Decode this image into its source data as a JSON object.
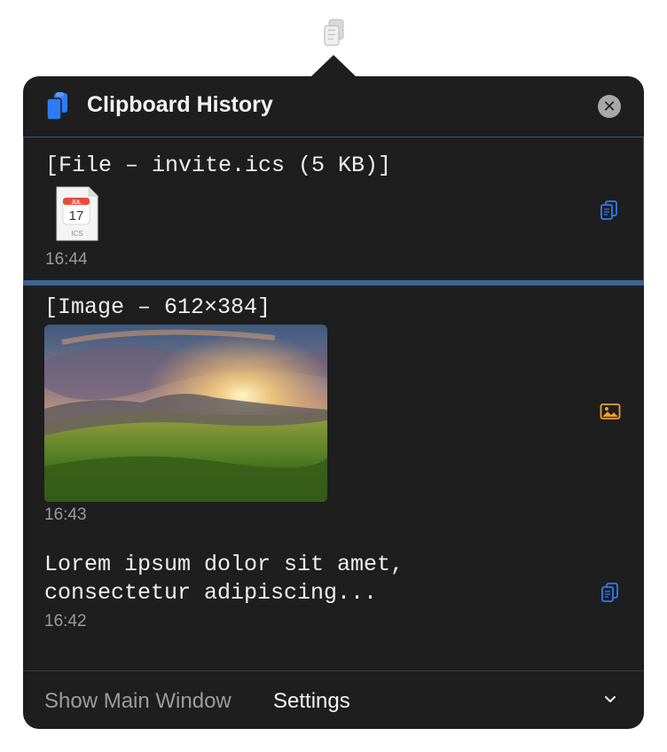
{
  "header": {
    "title": "Clipboard History"
  },
  "items": [
    {
      "label": "[File – invite.ics (5 KB)]",
      "time": "16:44",
      "file_icon": {
        "month": "JUL",
        "day": "17",
        "ext": "ICS"
      },
      "action_icon": "copy-icon"
    },
    {
      "label": "[Image – 612×384]",
      "time": "16:43",
      "action_icon": "image-icon"
    },
    {
      "label_line1": "Lorem ipsum dolor sit amet,",
      "label_line2": "consectetur adipiscing...",
      "time": "16:42",
      "action_icon": "copy-icon"
    }
  ],
  "footer": {
    "show_main": "Show Main Window",
    "settings": "Settings"
  },
  "colors": {
    "accent": "#2f7bf5",
    "image_accent": "#f0a030",
    "panel": "#1e1e1e",
    "selection": "#3a6494"
  }
}
